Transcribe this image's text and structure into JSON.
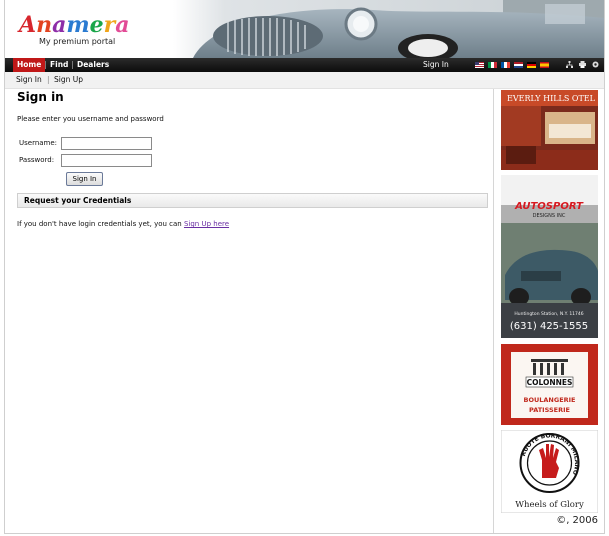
{
  "header": {
    "logo_text": "Anamera",
    "tagline": "My premium portal"
  },
  "nav": {
    "items": [
      {
        "label": "Home",
        "active": true
      },
      {
        "label": "Find",
        "active": false
      },
      {
        "label": "Dealers",
        "active": false
      }
    ],
    "signin_label": "Sign In"
  },
  "subnav": {
    "signin": "Sign In",
    "separator": "|",
    "signup": "Sign Up"
  },
  "main": {
    "title": "Sign in",
    "intro": "Please enter you username and password",
    "username_label": "Username:",
    "username_value": "",
    "password_label": "Password:",
    "password_value": "",
    "signin_button": "Sign In",
    "credentials_title": "Request your Credentials",
    "credentials_text": "If you don't have login credentials yet, you can ",
    "credentials_link": "Sign Up here"
  },
  "sidebar": {
    "ads": [
      {
        "name": "hotel",
        "text": "EVERLY HILLS OTEL"
      },
      {
        "name": "autosport",
        "title": "AUTOSPORT",
        "subtitle": "DESIGNS INC",
        "location": "Huntington Station, N.Y. 11746",
        "phone": "(631) 425-1555"
      },
      {
        "name": "colonnes",
        "title": "COLONNES",
        "line1": "BOULANGERIE",
        "line2": "PATISSERIE"
      },
      {
        "name": "ruote-borrani",
        "ring": "RUOTE BORRANI MILANO",
        "caption": "Wheels of Glory"
      }
    ],
    "copyright": "©, 2006"
  },
  "colors": {
    "nav_bg": "#111111",
    "nav_active": "#c01818",
    "link": "#6a2fa3",
    "autosport_red": "#d71920",
    "colonnes_red": "#c0281c"
  },
  "icons": [
    "flag-us-icon",
    "flag-it-icon",
    "flag-fr-icon",
    "flag-nl-icon",
    "flag-de-icon",
    "flag-es-icon",
    "sitemap-icon",
    "print-icon",
    "settings-icon"
  ]
}
